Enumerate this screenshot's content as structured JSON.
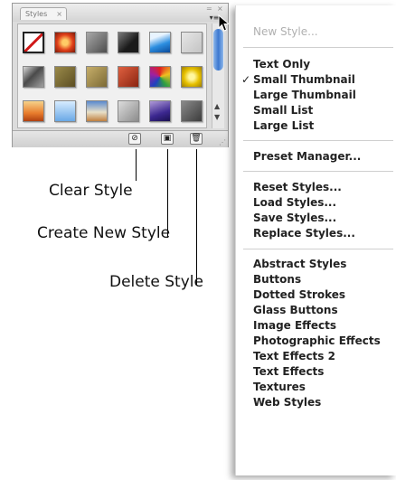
{
  "panel": {
    "tab_label": "Styles",
    "tab_close": "×",
    "minimize_glyph": "=",
    "close_glyph": "×",
    "menu_button_glyph": "▾≡",
    "scroll_up": "▲",
    "scroll_down": "▼",
    "swatches": [
      {
        "name": "default-none",
        "bg": "none"
      },
      {
        "name": "red-orange-glow",
        "bg": "radial-gradient(circle,#ffcc66 20%,#e0401a 55%,#7a1a0a 100%)"
      },
      {
        "name": "gray-bevel",
        "bg": "linear-gradient(135deg,#a8a8a8,#4e4e4e)"
      },
      {
        "name": "dark-checker",
        "bg": "linear-gradient(135deg,#7a7a7a,#1a1a1a 60%)"
      },
      {
        "name": "blue-glass",
        "bg": "linear-gradient(160deg,#e8f4ff 25%,#2c8ee0 60%,#0b4a9a)"
      },
      {
        "name": "light-gray-flat",
        "bg": "linear-gradient(135deg,#e6e6e6,#c4c4c4)"
      },
      {
        "name": "smoky-gradient",
        "bg": "linear-gradient(135deg,#d8d8d8,#4a4a4a 45%,#a0a0a0)"
      },
      {
        "name": "olive-texture",
        "bg": "linear-gradient(135deg,#9a8a4a,#5c4e22)"
      },
      {
        "name": "tan-texture",
        "bg": "linear-gradient(135deg,#c6ae6a,#7c6a34)"
      },
      {
        "name": "brick-red",
        "bg": "linear-gradient(135deg,#e06040,#8a2410)"
      },
      {
        "name": "rainbow-stripes",
        "bg": "conic-gradient(#e02020,#f0c020,#30a040,#2040c0,#a020a0,#e02020)"
      },
      {
        "name": "yellow-spark",
        "bg": "radial-gradient(circle,#fff7a0 20%,#e6c000 55%,#a08000)"
      },
      {
        "name": "sunset-orange",
        "bg": "linear-gradient(180deg,#f6d28a,#e87c2c 60%,#b04010)"
      },
      {
        "name": "sky-blue",
        "bg": "linear-gradient(180deg,#d8ecff,#6aa8e6)"
      },
      {
        "name": "ocean-horizon",
        "bg": "linear-gradient(180deg,#5a8ad0,#e8e0c8 55%,#c08040)"
      },
      {
        "name": "photo-gray",
        "bg": "linear-gradient(135deg,#dcdcdc,#8c8c8c)"
      },
      {
        "name": "purple-blue",
        "bg": "linear-gradient(160deg,#b09ad8,#3c2890 60%,#1a1050)"
      },
      {
        "name": "charcoal",
        "bg": "linear-gradient(135deg,#8a8a8a,#3c3c3c)"
      }
    ],
    "footer_buttons": {
      "clear_glyph": "⊘",
      "new_glyph": "▣",
      "delete_glyph": "🗑"
    },
    "resize_glyph": "⋰"
  },
  "callouts": {
    "clear_style": "Clear Style",
    "create_new_style": "Create New Style",
    "delete_style": "Delete Style"
  },
  "menu": {
    "check_glyph": "✓",
    "new_style": "New Style...",
    "text_only": "Text Only",
    "small_thumbnail": "Small Thumbnail",
    "large_thumbnail": "Large Thumbnail",
    "small_list": "Small List",
    "large_list": "Large List",
    "preset_manager": "Preset Manager...",
    "reset_styles": "Reset Styles...",
    "load_styles": "Load Styles...",
    "save_styles": "Save Styles...",
    "replace_styles": "Replace Styles...",
    "abstract_styles": "Abstract Styles",
    "buttons": "Buttons",
    "dotted_strokes": "Dotted Strokes",
    "glass_buttons": "Glass Buttons",
    "image_effects": "Image Effects",
    "photographic_effects": "Photographic Effects",
    "text_effects_2": "Text Effects 2",
    "text_effects": "Text Effects",
    "textures": "Textures",
    "web_styles": "Web Styles"
  }
}
